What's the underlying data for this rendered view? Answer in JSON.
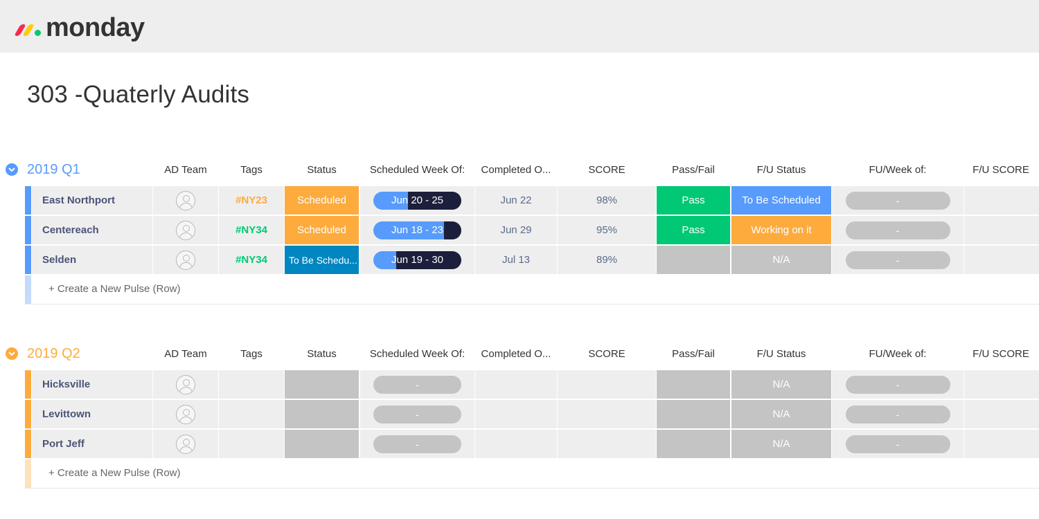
{
  "app": {
    "logo_text": "monday"
  },
  "page": {
    "title": "303 -Quaterly Audits"
  },
  "columns": [
    "AD Team",
    "Tags",
    "Status",
    "Scheduled Week Of:",
    "Completed O...",
    "SCORE",
    "Pass/Fail",
    "F/U Status",
    "FU/Week of:",
    "F/U SCORE"
  ],
  "colors": {
    "q1": "#579bfc",
    "q2": "#fdab3d",
    "q1_light": "#c5dbfb",
    "q2_light": "#fde2bb",
    "scheduled": "#fdab3d",
    "to_be_scheduled_dark": "#0086c0",
    "to_be_scheduled": "#579bfc",
    "pass": "#00c875",
    "working": "#fdab3d",
    "empty": "#c4c4c4",
    "tag_ny23": "#fdab3d",
    "tag_ny34": "#00c875"
  },
  "groups": [
    {
      "title": "2019 Q1",
      "create_label": "+ Create a New Pulse (Row)",
      "rows": [
        {
          "name": "East Northport",
          "tag": "#NY23",
          "status": "Scheduled",
          "timeline": "Jun 20 - 25",
          "timeline_progress": 0.39,
          "completed": "Jun 22",
          "score": "98%",
          "pass_fail": "Pass",
          "fu_status": "To Be Scheduled",
          "fu_week": "-"
        },
        {
          "name": "Centereach",
          "tag": "#NY34",
          "status": "Scheduled",
          "timeline": "Jun 18 - 23",
          "timeline_progress": 0.8,
          "completed": "Jun 29",
          "score": "95%",
          "pass_fail": "Pass",
          "fu_status": "Working on it",
          "fu_week": "-"
        },
        {
          "name": "Selden",
          "tag": "#NY34",
          "status": "To Be Schedu...",
          "timeline": "Jun 19 - 30",
          "timeline_progress": 0.26,
          "completed": "Jul 13",
          "score": "89%",
          "pass_fail": "",
          "fu_status": "N/A",
          "fu_week": "-"
        }
      ]
    },
    {
      "title": "2019 Q2",
      "create_label": "+ Create a New Pulse (Row)",
      "rows": [
        {
          "name": "Hicksville",
          "timeline": "-",
          "fu_status": "N/A",
          "fu_week": "-"
        },
        {
          "name": "Levittown",
          "timeline": "-",
          "fu_status": "N/A",
          "fu_week": "-"
        },
        {
          "name": "Port Jeff",
          "timeline": "-",
          "fu_status": "N/A",
          "fu_week": "-"
        }
      ]
    }
  ]
}
